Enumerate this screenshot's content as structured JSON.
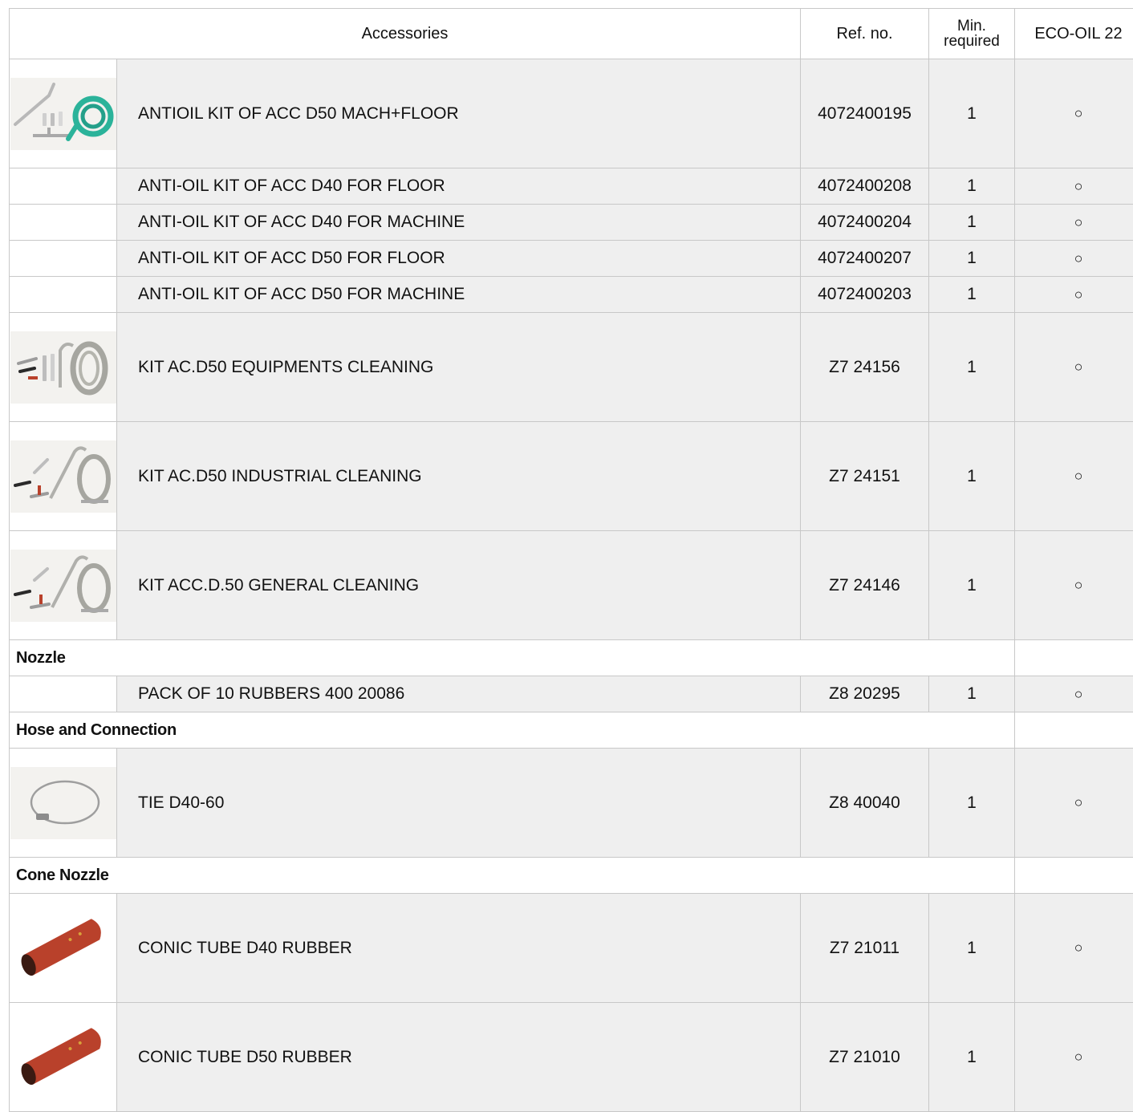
{
  "header": {
    "accessories": "Accessories",
    "ref": "Ref. no.",
    "min_line1": "Min.",
    "min_line2": "required",
    "eco": "ECO-OIL 22"
  },
  "rows": [
    {
      "name": "ANTIOIL KIT OF ACC D50  MACH+FLOOR",
      "ref": "4072400195",
      "min": "1",
      "eco": "○",
      "image": "kit-hose-green"
    },
    {
      "name": "ANTI-OIL KIT OF ACC D40 FOR FLOOR",
      "ref": "4072400208",
      "min": "1",
      "eco": "○"
    },
    {
      "name": "ANTI-OIL KIT OF ACC D40 FOR MACHINE",
      "ref": "4072400204",
      "min": "1",
      "eco": "○"
    },
    {
      "name": "ANTI-OIL KIT OF ACC D50 FOR FLOOR",
      "ref": "4072400207",
      "min": "1",
      "eco": "○"
    },
    {
      "name": "ANTI-OIL KIT OF ACC D50 FOR MACHINE",
      "ref": "4072400203",
      "min": "1",
      "eco": "○"
    },
    {
      "name": "KIT AC.D50 EQUIPMENTS CLEANING",
      "ref": "Z7 24156",
      "min": "1",
      "eco": "○",
      "image": "kit-hose-grey"
    },
    {
      "name": "KIT AC.D50 INDUSTRIAL CLEANING",
      "ref": "Z7 24151",
      "min": "1",
      "eco": "○",
      "image": "kit-hose-grey"
    },
    {
      "name": "KIT ACC.D.50 GENERAL CLEANING",
      "ref": "Z7 24146",
      "min": "1",
      "eco": "○",
      "image": "kit-hose-grey"
    }
  ],
  "sections": {
    "nozzle": {
      "title": "Nozzle",
      "rows": [
        {
          "name": "PACK OF 10 RUBBERS 400 20086",
          "ref": "Z8 20295",
          "min": "1",
          "eco": "○"
        }
      ]
    },
    "hose": {
      "title": "Hose and Connection",
      "rows": [
        {
          "name": "TIE D40-60",
          "ref": "Z8 40040",
          "min": "1",
          "eco": "○",
          "image": "hose-clamp"
        }
      ]
    },
    "cone": {
      "title": "Cone Nozzle",
      "rows": [
        {
          "name": "CONIC TUBE D40 RUBBER",
          "ref": "Z7 21011",
          "min": "1",
          "eco": "○",
          "image": "rubber-cone"
        },
        {
          "name": "CONIC TUBE D50 RUBBER",
          "ref": "Z7 21010",
          "min": "1",
          "eco": "○",
          "image": "rubber-cone"
        }
      ]
    }
  },
  "colors": {
    "hose_green": "#2bb39a",
    "hose_grey": "#a6a6a0",
    "rubber_red": "#b9412b",
    "row_bg": "#efefef",
    "border": "#c8c8c8"
  }
}
